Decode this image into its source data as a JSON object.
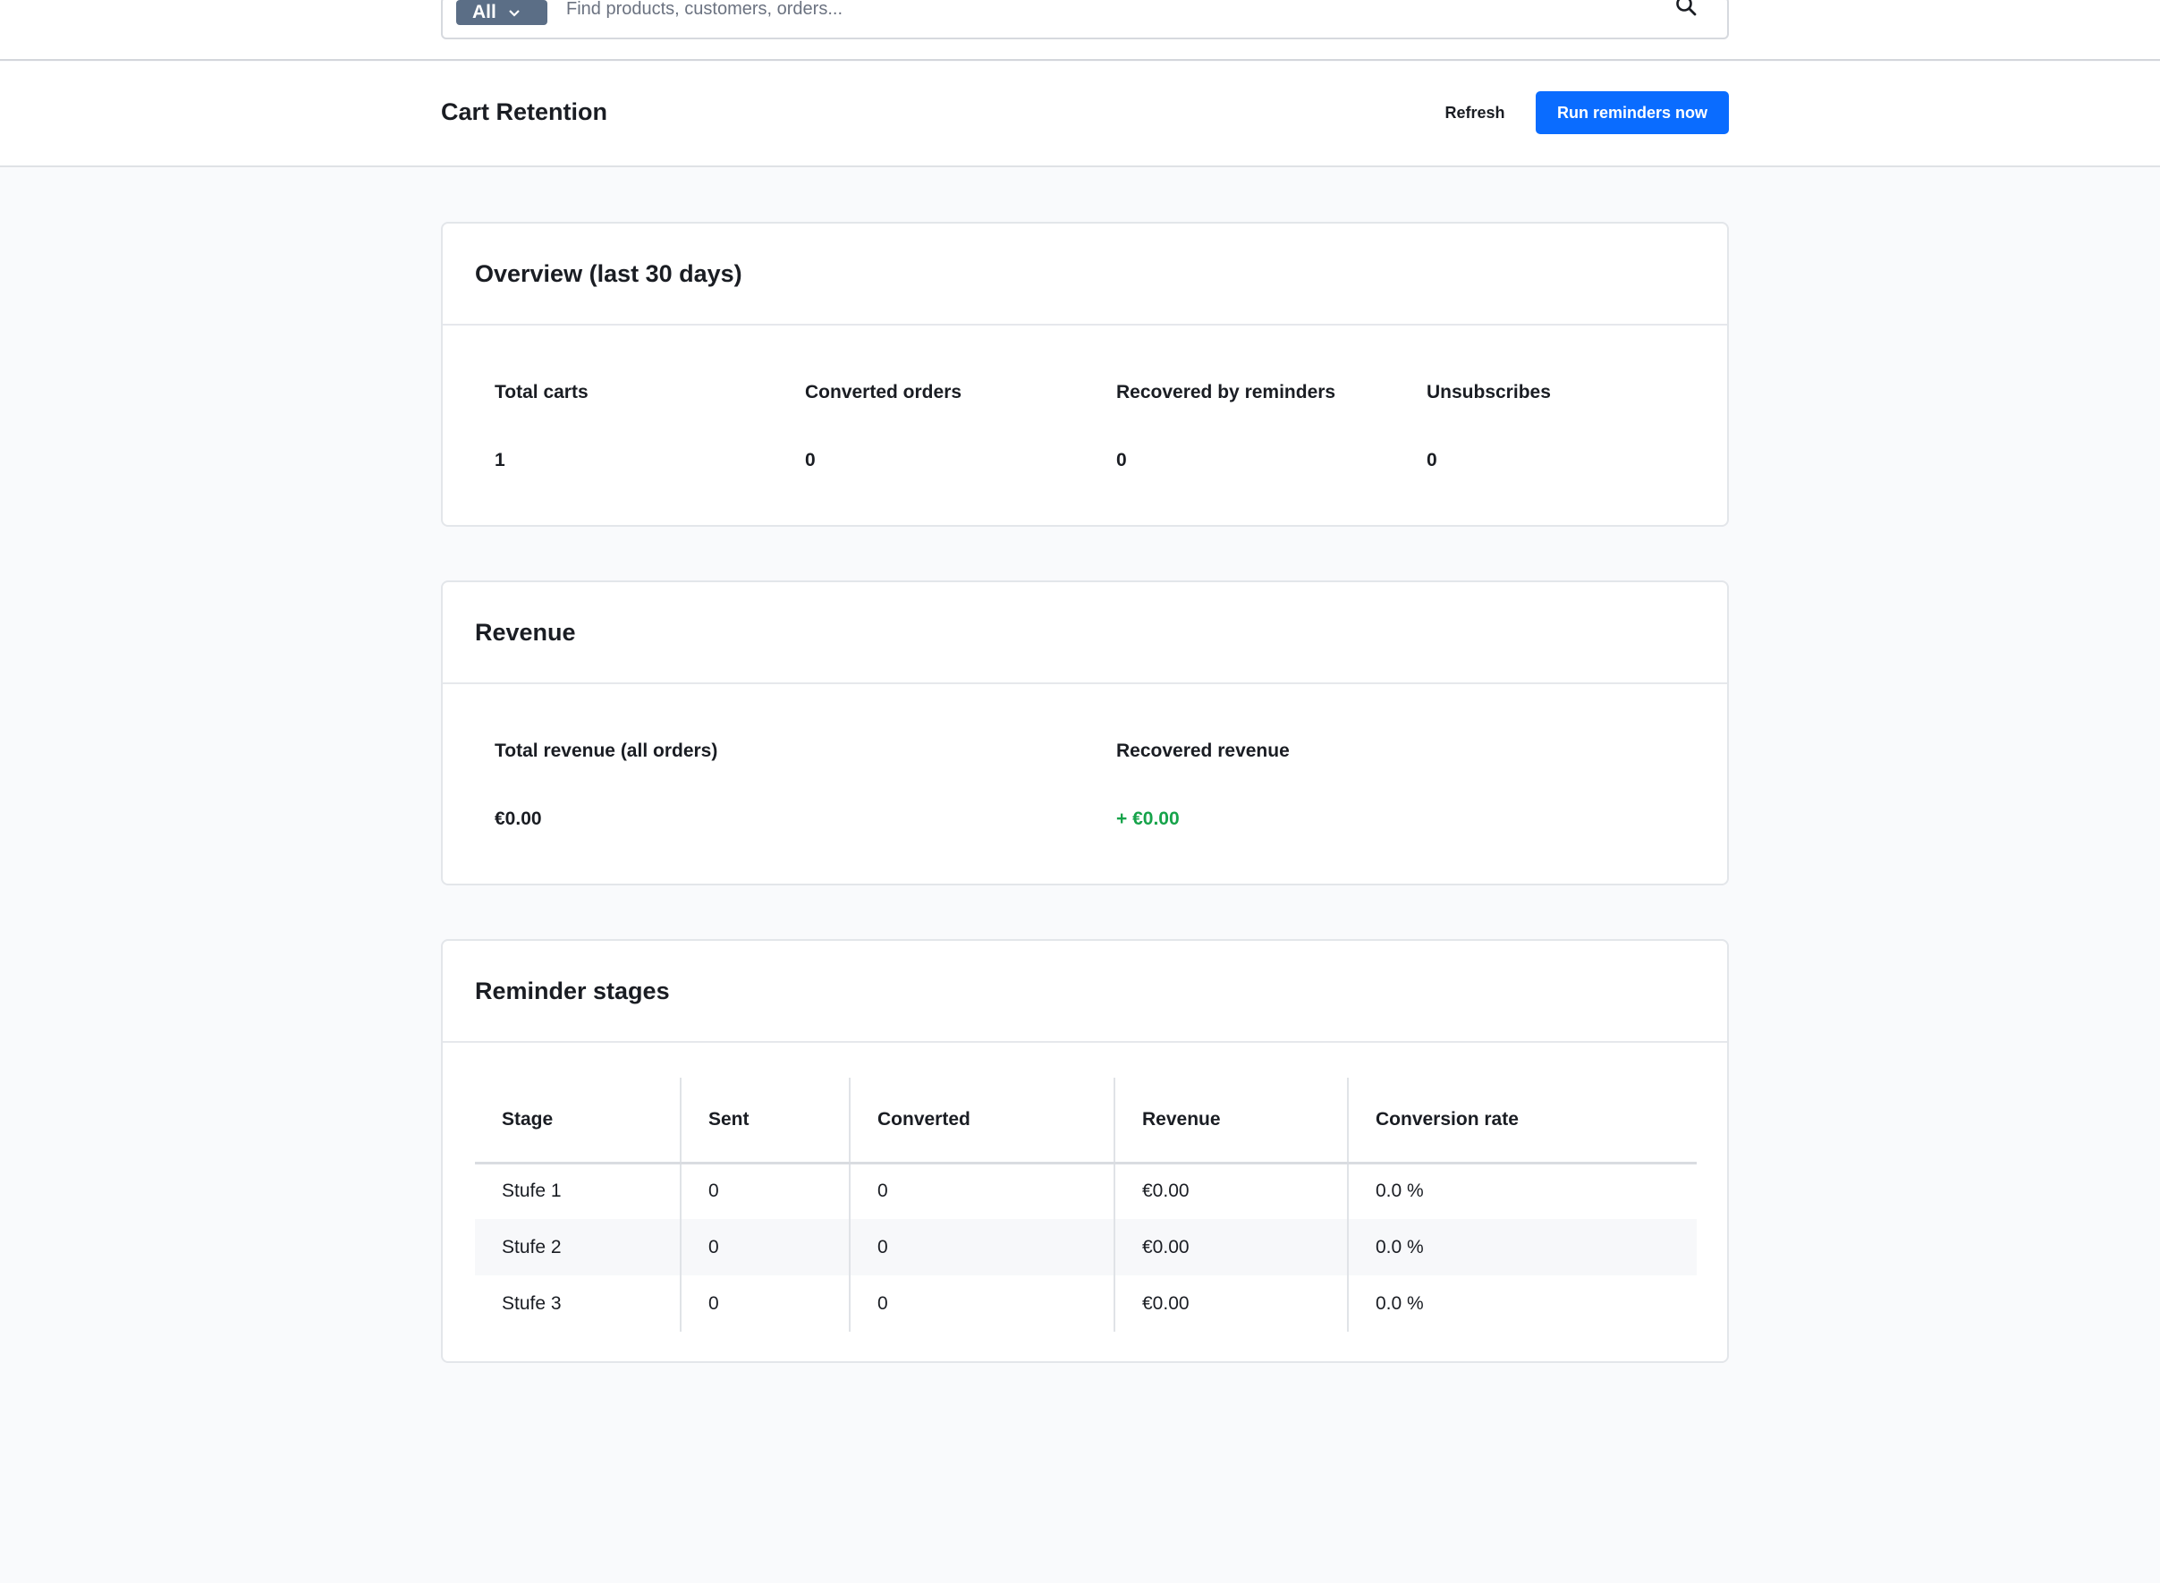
{
  "search": {
    "scope_label": "All",
    "placeholder": "Find products, customers, orders..."
  },
  "header": {
    "title": "Cart Retention",
    "refresh_label": "Refresh",
    "run_label": "Run reminders now"
  },
  "overview": {
    "title": "Overview (last 30 days)",
    "stats": [
      {
        "label": "Total carts",
        "value": "1"
      },
      {
        "label": "Converted orders",
        "value": "0"
      },
      {
        "label": "Recovered by reminders",
        "value": "0"
      },
      {
        "label": "Unsubscribes",
        "value": "0"
      }
    ]
  },
  "revenue": {
    "title": "Revenue",
    "stats": [
      {
        "label": "Total revenue (all orders)",
        "value": "€0.00"
      },
      {
        "label": "Recovered revenue",
        "value": "+ €0.00"
      }
    ],
    "recovered_color": "#16a34a"
  },
  "stages": {
    "title": "Reminder stages",
    "columns": [
      "Stage",
      "Sent",
      "Converted",
      "Revenue",
      "Conversion rate"
    ],
    "rows": [
      [
        "Stufe 1",
        "0",
        "0",
        "€0.00",
        "0.0 %"
      ],
      [
        "Stufe 2",
        "0",
        "0",
        "€0.00",
        "0.0 %"
      ],
      [
        "Stufe 3",
        "0",
        "0",
        "€0.00",
        "0.0 %"
      ]
    ]
  },
  "colors": {
    "primary": "#0a6cff",
    "scope_button": "#5b6e86",
    "background": "#f9fafc"
  },
  "icons": [
    "chevron-down-icon",
    "search-icon"
  ]
}
